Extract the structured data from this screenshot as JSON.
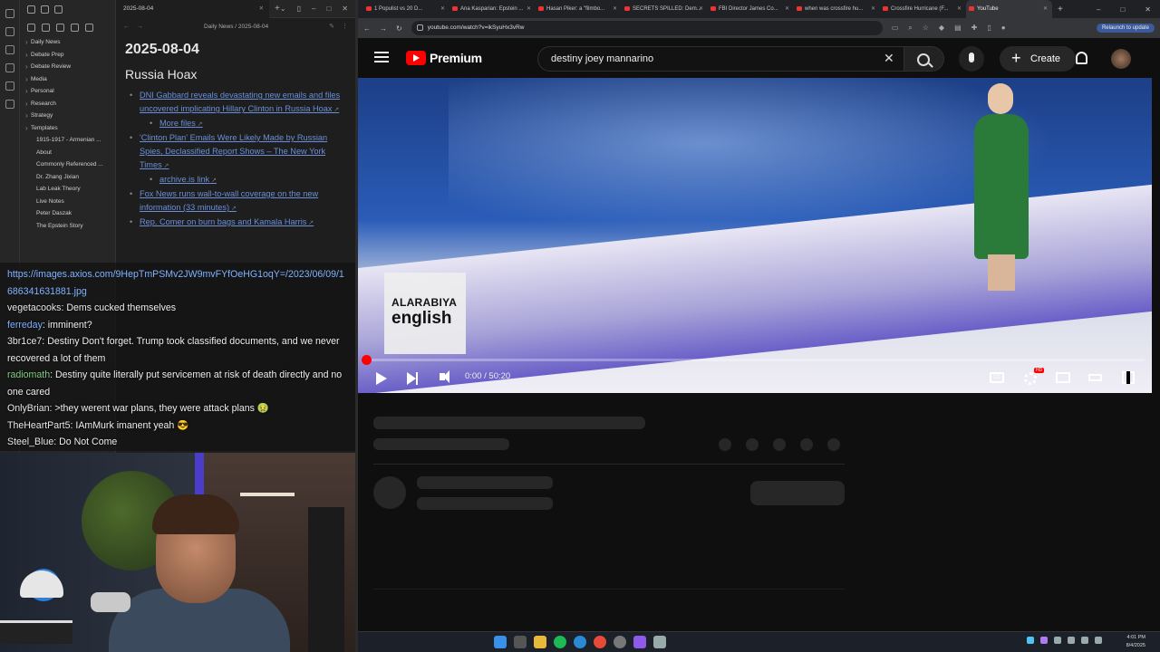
{
  "obsidian": {
    "tab_title": "2025-08-04",
    "breadcrumb": "Daily News / 2025-08-04",
    "sidebar_items": [
      {
        "label": "Daily News",
        "kind": "folder"
      },
      {
        "label": "Debate Prep",
        "kind": "folder"
      },
      {
        "label": "Debate Review",
        "kind": "folder"
      },
      {
        "label": "Media",
        "kind": "folder"
      },
      {
        "label": "Personal",
        "kind": "folder"
      },
      {
        "label": "Research",
        "kind": "folder"
      },
      {
        "label": "Strategy",
        "kind": "folder"
      },
      {
        "label": "Templates",
        "kind": "folder"
      },
      {
        "label": "1915-1917 - Armenian ...",
        "kind": "file"
      },
      {
        "label": "About",
        "kind": "file"
      },
      {
        "label": "Commonly Referenced ...",
        "kind": "file"
      },
      {
        "label": "Dr. Zhang Jixian",
        "kind": "file"
      },
      {
        "label": "Lab Leak Theory",
        "kind": "file"
      },
      {
        "label": "Live Notes",
        "kind": "file"
      },
      {
        "label": "Peter Daszak",
        "kind": "file"
      },
      {
        "label": "The Epstein Story",
        "kind": "file"
      }
    ],
    "note": {
      "title": "2025-08-04",
      "heading": "Russia Hoax",
      "links": [
        {
          "text": "DNI Gabbard reveals devastating new emails and files uncovered implicating Hillary Clinton in Russia Hoax",
          "sub": false
        },
        {
          "text": "More files",
          "sub": true
        },
        {
          "text": "'Clinton Plan' Emails Were Likely Made by Russian Spies, Declassified Report Shows – The New York Times",
          "sub": false
        },
        {
          "text": "archive.is link",
          "sub": true
        },
        {
          "text": "Fox News runs wall-to-wall coverage on the new information (33 minutes)",
          "sub": false
        },
        {
          "text": "Rep. Comer on burn bags and Kamala Harris",
          "sub": false
        }
      ]
    }
  },
  "chat": {
    "url_line": "https://images.axios.com/9HepTmPSMv2JW9mvFYfOeHG1oqY=/2023/06/09/1686341631881.jpg",
    "messages": [
      {
        "user": "vegetacooks",
        "text": "Dems cucked themselves",
        "color": "#e8e8e8"
      },
      {
        "user": "ferreday",
        "text": "imminent?",
        "color": "#7fb2ff"
      },
      {
        "user": "3br1ce7",
        "text": "Destiny Don't forget. Trump took classified documents, and we never recovered a lot of them",
        "color": "#e8e8e8"
      },
      {
        "user": "radiomath",
        "text": "Destiny quite literally put servicemen at risk of death directly and no one cared",
        "color": "#7fd07f"
      },
      {
        "user": "OnlyBrian",
        "text": ">they werent war plans, they were attack plans 🤢",
        "color": "#e8e8e8"
      },
      {
        "user": "TheHeartPart5",
        "text": "IAmMurk imanent yeah 😎",
        "color": "#e8e8e8"
      },
      {
        "user": "Steel_Blue",
        "text": "Do Not Come",
        "color": "#e8e8e8"
      }
    ]
  },
  "chrome": {
    "tabs": [
      {
        "label": "1 Populist vs 20 D..."
      },
      {
        "label": "Ana Kasparian: Epstein ..."
      },
      {
        "label": "Hasan Piker: a \"filmbo..."
      },
      {
        "label": "SECRETS SPILLED: Dem..."
      },
      {
        "label": "FBI Director James Co..."
      },
      {
        "label": "when was crossfire hu..."
      },
      {
        "label": "Crossfire Hurricane (F..."
      },
      {
        "label": "YouTube"
      }
    ],
    "url": "youtube.com/watch?v=ikSyuHx3vRw",
    "relaunch_label": "Relaunch to update"
  },
  "youtube": {
    "brand": "Premium",
    "search_value": "destiny joey mannarino",
    "create_label": "Create",
    "watermark_line1": "ALARABIYA",
    "watermark_line2": "english",
    "time": "0:00 / 50:20",
    "progress": 0.0,
    "cc_label": "CC",
    "hd_badge": "HD"
  },
  "taskbar": {
    "time": "4:01 PM",
    "date": "8/4/2025"
  },
  "colors": {
    "accent_red": "#ff0000",
    "link_blue": "#6a8fd8",
    "relaunch_bg": "#3c5a9a"
  }
}
